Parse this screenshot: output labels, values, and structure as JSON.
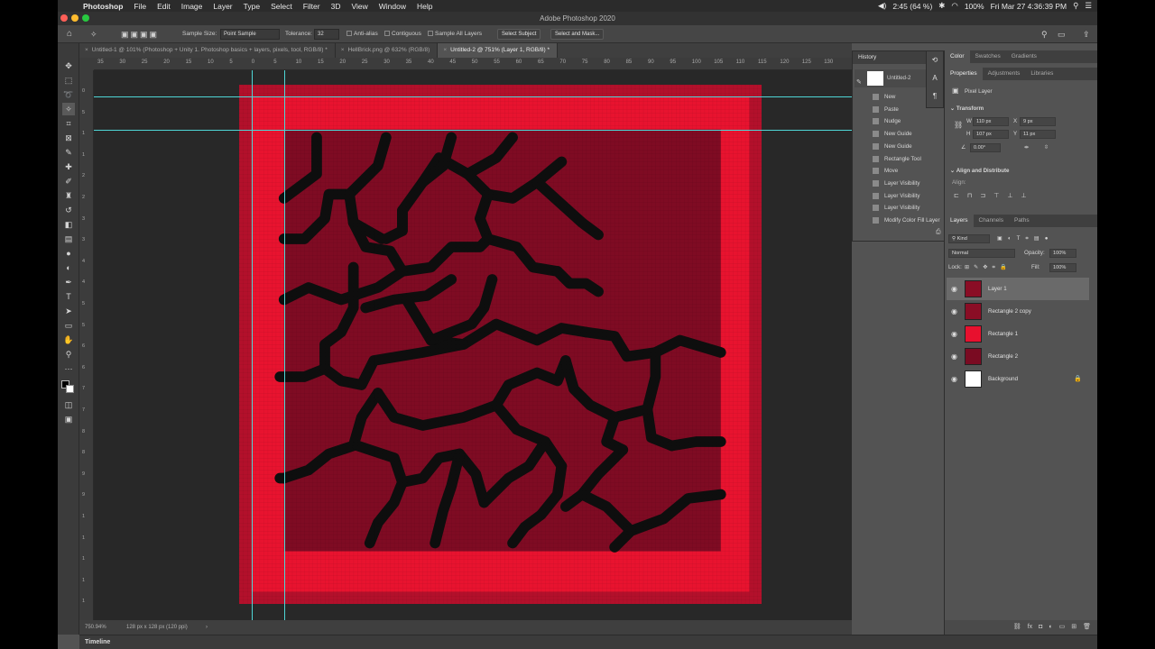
{
  "menubar": {
    "app_name": "Photoshop",
    "items": [
      "File",
      "Edit",
      "Image",
      "Layer",
      "Type",
      "Select",
      "Filter",
      "3D",
      "View",
      "Window",
      "Help"
    ],
    "battery_time": "2:45 (64 %)",
    "battery_pct": "100%",
    "clock": "Fri Mar 27  4:36:39 PM"
  },
  "window": {
    "title": "Adobe Photoshop 2020"
  },
  "options": {
    "sample_size_label": "Sample Size:",
    "sample_size_value": "Point Sample",
    "tolerance_label": "Tolerance:",
    "tolerance_value": "32",
    "anti_alias": "Anti-alias",
    "contiguous": "Contiguous",
    "sample_all_layers": "Sample All Layers",
    "select_subject": "Select Subject",
    "select_mask": "Select and Mask..."
  },
  "tabs": [
    {
      "label": "Untitled-1 @ 101% (Photoshop + Unity 1. Photoshop basics  + layers, pixels, tool, RGB/8) *"
    },
    {
      "label": "HellBrick.png @ 632% (RGB/8)"
    },
    {
      "label": "Untitled-2 @ 751% (Layer 1, RGB/8) *"
    }
  ],
  "ruler": {
    "top_labels": [
      "35",
      "30",
      "25",
      "20",
      "15",
      "10",
      "5",
      "0",
      "5",
      "10",
      "15",
      "20",
      "25",
      "30",
      "35",
      "40",
      "45",
      "50",
      "55",
      "60",
      "65",
      "70",
      "75",
      "80",
      "85",
      "90",
      "95",
      "100",
      "105",
      "110",
      "115",
      "120",
      "125",
      "130"
    ],
    "left_labels": [
      "0",
      "5",
      "1",
      "1",
      "2",
      "2",
      "3",
      "3",
      "4",
      "4",
      "5",
      "5",
      "6",
      "6",
      "7",
      "7",
      "8",
      "8",
      "9",
      "9",
      "1",
      "1",
      "1",
      "1",
      "1"
    ]
  },
  "status": {
    "zoom": "750.94%",
    "doc_size": "128 px x 128 px (120 ppi)"
  },
  "timeline": {
    "label": "Timeline"
  },
  "history": {
    "title": "History",
    "snapshot": "Untitled-2",
    "items": [
      "New",
      "Paste",
      "Nudge",
      "New Guide",
      "New Guide",
      "Rectangle Tool",
      "Move",
      "Layer Visibility",
      "Layer Visibility",
      "Layer Visibility",
      "Modify Color Fill Layer"
    ]
  },
  "color_tabs": [
    "Color",
    "Swatches",
    "Gradients"
  ],
  "prop_tabs": [
    "Properties",
    "Adjustments",
    "Libraries"
  ],
  "properties": {
    "kind": "Pixel Layer",
    "transform_label": "Transform",
    "w_label": "W",
    "w_value": "110 px",
    "x_label": "X",
    "x_value": "9 px",
    "h_label": "H",
    "h_value": "107 px",
    "y_label": "Y",
    "y_value": "11 px",
    "angle": "0.00°",
    "align_label": "Align and Distribute",
    "align_sub": "Align:"
  },
  "layer_tabs": [
    "Layers",
    "Channels",
    "Paths"
  ],
  "layers_panel": {
    "kind_filter": "Kind",
    "blend_mode": "Normal",
    "opacity_label": "Opacity:",
    "opacity_value": "100%",
    "lock_label": "Lock:",
    "fill_label": "Fill:",
    "fill_value": "100%"
  },
  "layers": [
    {
      "name": "Layer 1",
      "thumb_color": "#8a0d25",
      "selected": true
    },
    {
      "name": "Rectangle 2 copy",
      "thumb_color": "#8a0d25",
      "selected": false
    },
    {
      "name": "Rectangle 1",
      "thumb_color": "#e8102e",
      "selected": false
    },
    {
      "name": "Rectangle 2",
      "thumb_color": "#7a0b22",
      "selected": false
    },
    {
      "name": "Background",
      "thumb_color": "#ffffff",
      "selected": false
    }
  ],
  "colors": {
    "outer_frame": "#b3102b",
    "border_red": "#e8132f",
    "inner_field": "#7f0b23",
    "crack": "#0e0e0e",
    "guide": "#4ed6d6"
  }
}
